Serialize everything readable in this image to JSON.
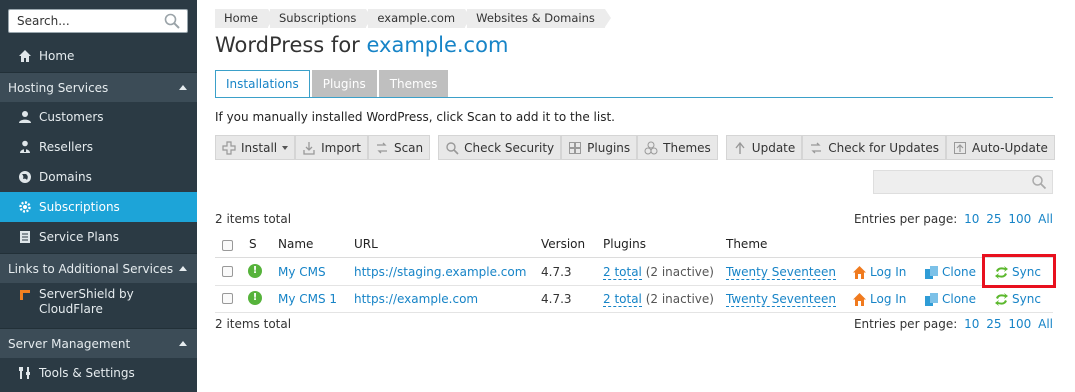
{
  "sidebar": {
    "search_placeholder": "Search...",
    "home": "Home",
    "sections": {
      "hosting": "Hosting Services",
      "links": "Links to Additional Services",
      "server": "Server Management"
    },
    "hosting_items": [
      "Customers",
      "Resellers",
      "Domains",
      "Subscriptions",
      "Service Plans"
    ],
    "links_items": [
      "ServerShield by",
      "CloudFlare"
    ],
    "server_items": [
      "Tools & Settings"
    ]
  },
  "breadcrumbs": [
    "Home",
    "Subscriptions",
    "example.com",
    "Websites & Domains"
  ],
  "page": {
    "title_prefix": "WordPress for",
    "title_domain": "example.com"
  },
  "tabs": [
    "Installations",
    "Plugins",
    "Themes"
  ],
  "info_text": "If you manually installed WordPress, click Scan to add it to the list.",
  "toolbar": {
    "install": "Install",
    "import": "Import",
    "scan": "Scan",
    "check_security": "Check Security",
    "plugins": "Plugins",
    "themes": "Themes",
    "update": "Update",
    "check_updates": "Check for Updates",
    "auto_update": "Auto-Update"
  },
  "list": {
    "items_total": "2 items total",
    "entries_per_page_label": "Entries per page:",
    "page_sizes": [
      "10",
      "25",
      "100",
      "All"
    ],
    "columns": [
      "S",
      "Name",
      "URL",
      "Version",
      "Plugins",
      "Theme"
    ],
    "rows": [
      {
        "name": "My CMS",
        "url": "https://staging.example.com",
        "version": "4.7.3",
        "plugins_link": "2 total",
        "plugins_note": "(2 inactive)",
        "theme": "Twenty Seventeen",
        "login": "Log In",
        "clone": "Clone",
        "sync": "Sync"
      },
      {
        "name": "My CMS 1",
        "url": "https://example.com",
        "version": "4.7.3",
        "plugins_link": "2 total",
        "plugins_note": "(2 inactive)",
        "theme": "Twenty Seventeen",
        "login": "Log In",
        "clone": "Clone",
        "sync": "Sync"
      }
    ]
  },
  "colors": {
    "sidebar_bg": "#2b3a44",
    "active": "#1da4d8",
    "link": "#1784c7",
    "highlight": "#e8101e",
    "status_ok": "#56b33b"
  }
}
